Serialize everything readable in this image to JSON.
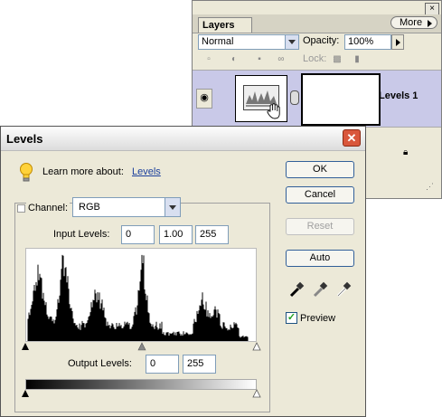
{
  "layers_panel": {
    "close_glyph": "×",
    "tab_label": "Layers",
    "more_label": "More",
    "blend_mode": "Normal",
    "opacity_label": "Opacity:",
    "opacity_value": "100%",
    "lock_label": "Lock:",
    "layer_name": "Levels 1"
  },
  "levels_dialog": {
    "title": "Levels",
    "close_glyph": "✕",
    "learn_more": "Learn more about:",
    "learn_more_link": "Levels",
    "channel_label": "Channel:",
    "channel_value": "RGB",
    "input_levels_label": "Input Levels:",
    "input_black": "0",
    "input_gamma": "1.00",
    "input_white": "255",
    "output_levels_label": "Output Levels:",
    "output_black": "0",
    "output_white": "255",
    "buttons": {
      "ok": "OK",
      "cancel": "Cancel",
      "reset": "Reset",
      "auto": "Auto"
    },
    "preview_label": "Preview",
    "preview_checked": true
  },
  "colors": {
    "accent_border": "#315f99",
    "link": "#1a3f9c",
    "close_red": "#d9573c",
    "layer_selected": "#c9c9e8"
  },
  "icons": [
    "eye-icon",
    "lightbulb-icon",
    "black-eyedropper-icon",
    "gray-eyedropper-icon",
    "white-eyedropper-icon",
    "lock-icon",
    "hand-cursor-icon"
  ]
}
